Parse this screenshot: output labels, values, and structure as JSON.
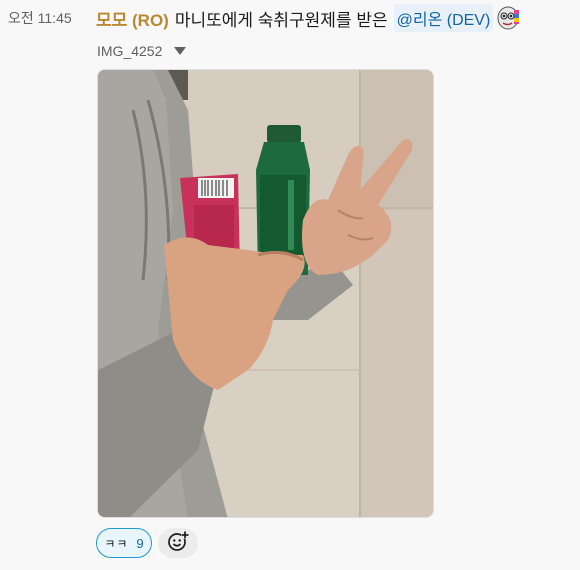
{
  "message": {
    "timestamp": "오전 11:45",
    "author": "모모 (RO)",
    "text": "마니또에게 숙취구원제를 받은",
    "mention": "@리온 (DEV)",
    "custom_emoji_icon": "custom-face-emoji"
  },
  "attachment": {
    "file_name": "IMG_4252",
    "toggle_icon": "caret-down-icon",
    "image_description_icon": "photo-peace-sign-with-drinks"
  },
  "reactions": [
    {
      "emoji": "ㅋㅋ",
      "count": "9",
      "selected": true
    }
  ],
  "add_reaction_icon": "add-emoji-icon",
  "colors": {
    "author": "#b8892f",
    "mention": "#1264a3",
    "mention_bg": "#e8f1f9",
    "reaction_border": "#1d9bd1",
    "reaction_bg": "#e8f5fa"
  }
}
